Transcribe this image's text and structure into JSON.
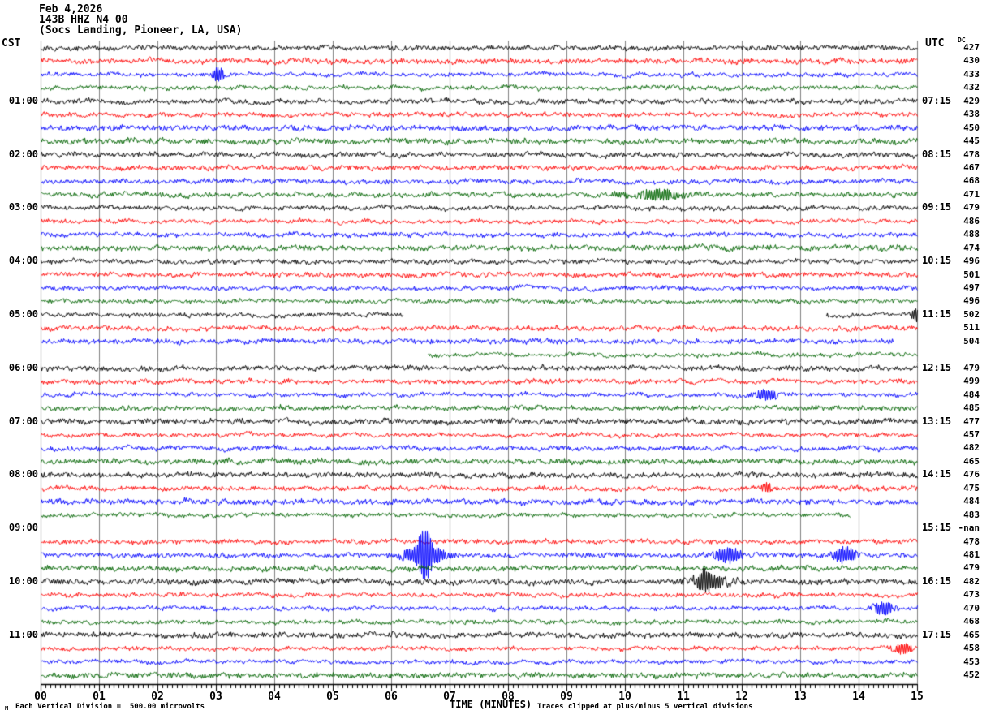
{
  "header": {
    "date": "Feb 4,2026",
    "station": "143B HHZ N4 00",
    "location": "(Socs Landing, Pioneer, LA, USA)"
  },
  "axes": {
    "left_tz": "CST",
    "right_tz": "UTC",
    "dc_label": "DC",
    "xlabel": "TIME (MINUTES)",
    "x_ticks": [
      "00",
      "01",
      "02",
      "03",
      "04",
      "05",
      "06",
      "07",
      "08",
      "09",
      "10",
      "11",
      "12",
      "13",
      "14",
      "15"
    ]
  },
  "footer": {
    "corner_glyph": "M",
    "scale_note": "Each Vertical Division =  500.00 microvolts",
    "clip_note": "Traces clipped at plus/minus 5 vertical divisions"
  },
  "chart_data": {
    "type": "line",
    "subtype": "helicorder-seismogram",
    "title": "143B HHZ N4 00 (Socs Landing, Pioneer, LA, USA) Feb 4,2026",
    "xlabel": "TIME (MINUTES)",
    "x_range": [
      0,
      15
    ],
    "minutes_per_line": 15,
    "lines_per_hour": 4,
    "volts_per_division": "500.00 microvolts",
    "clip_limit": "plus/minus 5 vertical divisions",
    "grid": true,
    "grid_color": "#808080",
    "trace_colors_cycle": [
      "#000000",
      "#ff0000",
      "#0000ff",
      "#006400"
    ],
    "rows": [
      {
        "dc": "427"
      },
      {
        "dc": "430"
      },
      {
        "dc": "433",
        "events": [
          {
            "x": 3.03,
            "w": 0.08,
            "amp": 8
          }
        ]
      },
      {
        "dc": "432"
      },
      {
        "dc": "429",
        "cst": "01:00",
        "utc": "07:15"
      },
      {
        "dc": "438"
      },
      {
        "dc": "450"
      },
      {
        "dc": "445"
      },
      {
        "dc": "478",
        "cst": "02:00",
        "utc": "08:15"
      },
      {
        "dc": "467"
      },
      {
        "dc": "468"
      },
      {
        "dc": "471",
        "events": [
          {
            "x": 10.56,
            "w": 0.35,
            "amp": 5
          }
        ]
      },
      {
        "dc": "479",
        "cst": "03:00",
        "utc": "09:15"
      },
      {
        "dc": "486"
      },
      {
        "dc": "488"
      },
      {
        "dc": "474"
      },
      {
        "dc": "496",
        "cst": "04:00",
        "utc": "10:15"
      },
      {
        "dc": "501"
      },
      {
        "dc": "497"
      },
      {
        "dc": "496"
      },
      {
        "dc": "502",
        "cst": "05:00",
        "utc": "11:15",
        "segments": [
          [
            0,
            6.2
          ],
          [
            13.45,
            15
          ]
        ],
        "events": [
          {
            "x": 14.96,
            "w": 0.05,
            "amp": 8
          }
        ]
      },
      {
        "dc": "511"
      },
      {
        "dc": "504",
        "segments": [
          [
            0,
            14.58
          ]
        ]
      },
      {
        "dc": null,
        "segments": [
          [
            6.63,
            15
          ]
        ]
      },
      {
        "dc": "479",
        "cst": "06:00",
        "utc": "12:15"
      },
      {
        "dc": "499"
      },
      {
        "dc": "484",
        "events": [
          {
            "x": 12.43,
            "w": 0.14,
            "amp": 6
          }
        ]
      },
      {
        "dc": "485"
      },
      {
        "dc": "477",
        "cst": "07:00",
        "utc": "13:15"
      },
      {
        "dc": "457"
      },
      {
        "dc": "482"
      },
      {
        "dc": "465"
      },
      {
        "dc": "476",
        "cst": "08:00",
        "utc": "14:15"
      },
      {
        "dc": "475",
        "events": [
          {
            "x": 12.44,
            "w": 0.06,
            "amp": 6
          }
        ]
      },
      {
        "dc": "484"
      },
      {
        "dc": "483",
        "segments": [
          [
            0,
            13.85
          ]
        ]
      },
      {
        "dc": "-nan",
        "cst": "09:00",
        "utc": "15:15",
        "segments": []
      },
      {
        "dc": "478"
      },
      {
        "dc": "481",
        "events": [
          {
            "x": 6.57,
            "w": 0.07,
            "amp": 27
          },
          {
            "x": 6.57,
            "w": 0.25,
            "amp": 11
          },
          {
            "x": 11.76,
            "w": 0.17,
            "amp": 9
          },
          {
            "x": 13.75,
            "w": 0.14,
            "amp": 9
          }
        ]
      },
      {
        "dc": "479"
      },
      {
        "dc": "482",
        "cst": "10:00",
        "utc": "16:15",
        "events": [
          {
            "x": 11.36,
            "w": 0.05,
            "amp": 10
          },
          {
            "x": 11.46,
            "w": 0.3,
            "amp": 6
          }
        ]
      },
      {
        "dc": "473"
      },
      {
        "dc": "470",
        "events": [
          {
            "x": 14.42,
            "w": 0.12,
            "amp": 7
          }
        ]
      },
      {
        "dc": "468"
      },
      {
        "dc": "465",
        "cst": "11:00",
        "utc": "17:15"
      },
      {
        "dc": "458",
        "events": [
          {
            "x": 14.75,
            "w": 0.12,
            "amp": 6
          }
        ]
      },
      {
        "dc": "453"
      },
      {
        "dc": "452"
      }
    ]
  }
}
